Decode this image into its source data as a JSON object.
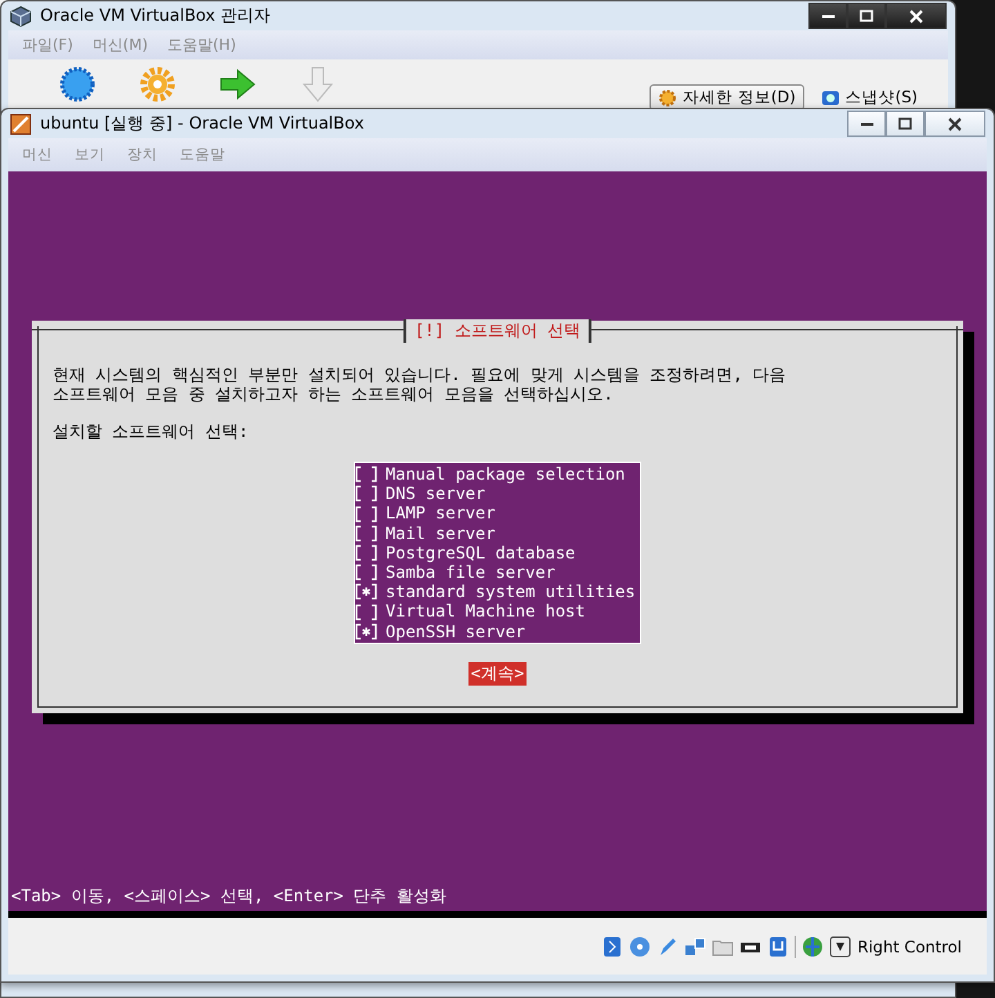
{
  "manager": {
    "title": "Oracle VM VirtualBox 관리자",
    "menu": [
      "파일(F)",
      "머신(M)",
      "도움말(H)"
    ],
    "view_tabs": [
      {
        "label": "자세한 정보(D)",
        "selected": true
      },
      {
        "label": "스냅샷(S)",
        "selected": false
      }
    ]
  },
  "vm": {
    "title": "ubuntu [실행 중] - Oracle VM VirtualBox",
    "menu": [
      "머신",
      "보기",
      "장치",
      "도움말"
    ],
    "dialog": {
      "title": "[!] 소프트웨어 선택",
      "description": "현재 시스템의 핵심적인 부분만 설치되어 있습니다. 필요에 맞게 시스템을 조정하려면, 다음\n소프트웨어 모음 중 설치하고자 하는 소프트웨어 모음을 선택하십시오.",
      "prompt": "설치할 소프트웨어 선택:",
      "options": [
        {
          "label": "Manual package selection",
          "checked": false
        },
        {
          "label": "DNS server",
          "checked": false
        },
        {
          "label": "LAMP server",
          "checked": false
        },
        {
          "label": "Mail server",
          "checked": false
        },
        {
          "label": "PostgreSQL database",
          "checked": false
        },
        {
          "label": "Samba file server",
          "checked": false
        },
        {
          "label": "standard system utilities",
          "checked": true
        },
        {
          "label": "Virtual Machine host",
          "checked": false
        },
        {
          "label": "OpenSSH server",
          "checked": true
        }
      ],
      "button": "<계속>"
    },
    "help_line": "<Tab> 이동, <스페이스> 선택, <Enter> 단추 활성화",
    "host_key": "Right Control"
  }
}
